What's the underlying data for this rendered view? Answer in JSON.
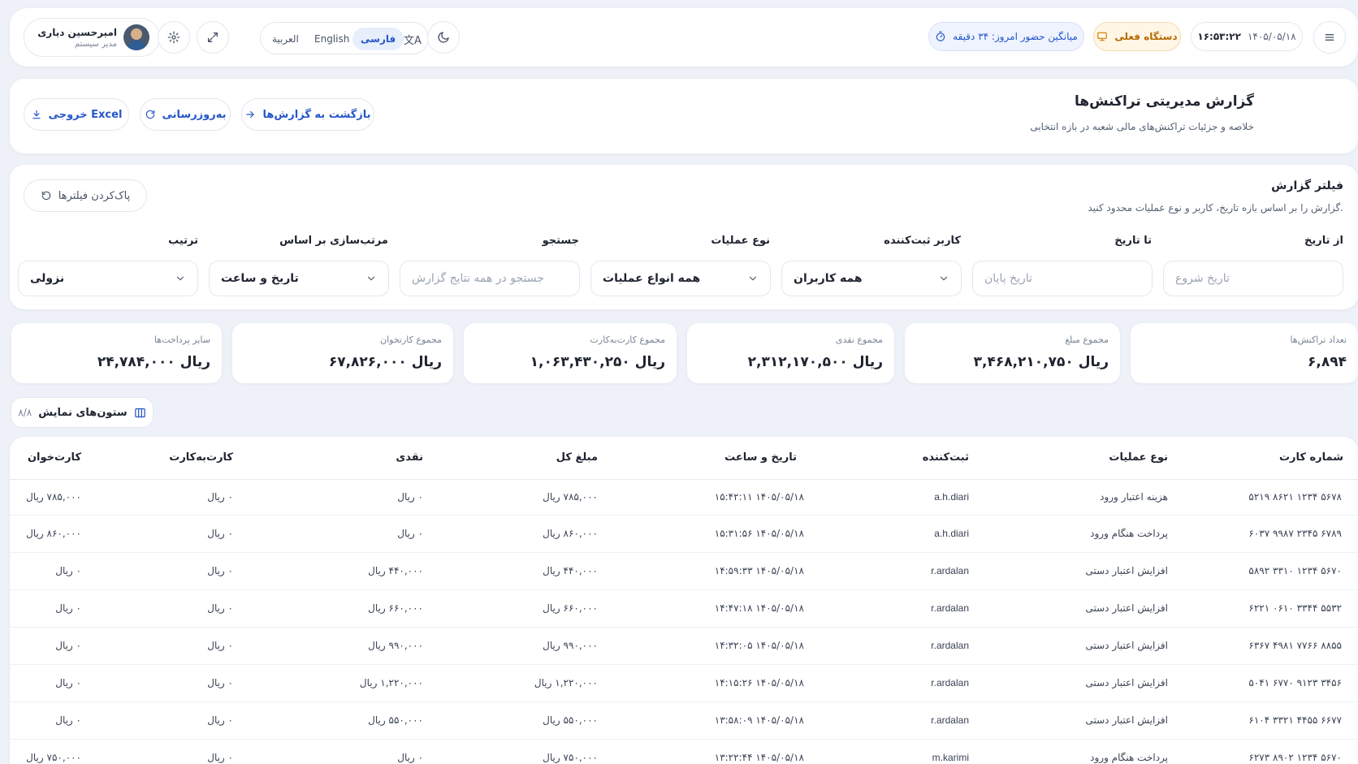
{
  "header": {
    "user_name": "امیرحسین دیاری",
    "user_role": "مدیر سیستم",
    "lang_arabic": "العربية",
    "lang_english": "English",
    "lang_farsi": "فارسی",
    "avg_presence": "میانگین حضور امروز: ۳۴ دقیقه",
    "current_device": "دستگاه فعلی",
    "time": "۱۶:۵۳:۲۲",
    "date": "۱۴۰۵/۰۵/۱۸"
  },
  "page": {
    "title": "گزارش مدیریتی تراکنش‌ها",
    "subtitle": "خلاصه و جزئیات تراکنش‌های مالی شعبه در بازه انتخابی",
    "back_label": "بازگشت به گزارش‌ها",
    "refresh_label": "به‌روزرسانی",
    "excel_label": "خروجی Excel"
  },
  "filter": {
    "title": "فیلتر گزارش",
    "description": "گزارش را بر اساس بازه تاریخ، کاربر و نوع عملیات محدود کنید.",
    "clear_label": "پاک‌کردن فیلترها",
    "from_label": "از تاریخ",
    "from_placeholder": "تاریخ شروع",
    "to_label": "تا تاریخ",
    "to_placeholder": "تاریخ پایان",
    "user_label": "کاربر ثبت‌کننده",
    "user_value": "همه کاربران",
    "op_label": "نوع عملیات",
    "op_value": "همه انواع عملیات",
    "search_label": "جستجو",
    "search_placeholder": "جستجو در همه نتایج گزارش",
    "sort_label": "مرتب‌سازی بر اساس",
    "sort_value": "تاریخ و ساعت",
    "order_label": "ترتیب",
    "order_value": "نزولی"
  },
  "stats": [
    {
      "label": "تعداد تراکنش‌ها",
      "value": "۶,۸۹۴"
    },
    {
      "label": "مجموع مبلغ",
      "value": "۳,۴۶۸,۲۱۰,۷۵۰ ریال"
    },
    {
      "label": "مجموع نقدی",
      "value": "۲,۳۱۲,۱۷۰,۵۰۰ ریال"
    },
    {
      "label": "مجموع کارت‌به‌کارت",
      "value": "۱,۰۶۳,۴۳۰,۲۵۰ ریال"
    },
    {
      "label": "مجموع کارتخوان",
      "value": "۶۷,۸۲۶,۰۰۰ ریال"
    },
    {
      "label": "سایر پرداخت‌ها",
      "value": "۲۴,۷۸۴,۰۰۰ ریال"
    }
  ],
  "columns_button": {
    "label": "ستون‌های نمایش",
    "count": "۸/۸"
  },
  "table": {
    "headers": [
      "شماره کارت",
      "نوع عملیات",
      "ثبت‌کننده",
      "تاریخ و ساعت",
      "مبلغ کل",
      "نقدی",
      "کارت‌به‌کارت",
      "کارت‌خوان"
    ],
    "rows": [
      [
        "۵۶۷۸ ۱۲۳۴ ۸۶۲۱ ۵۲۱۹",
        "هزینه اعتبار ورود",
        "a.h.diari",
        "۱۴۰۵/۰۵/۱۸   ۱۵:۴۲:۱۱",
        "۷۸۵,۰۰۰ ریال",
        "۰ ریال",
        "۰ ریال",
        "۷۸۵,۰۰۰ ریال"
      ],
      [
        "۶۷۸۹ ۲۳۴۵ ۹۹۸۷ ۶۰۳۷",
        "پرداخت هنگام ورود",
        "a.h.diari",
        "۱۴۰۵/۰۵/۱۸   ۱۵:۳۱:۵۶",
        "۸۶۰,۰۰۰ ریال",
        "۰ ریال",
        "۰ ریال",
        "۸۶۰,۰۰۰ ریال"
      ],
      [
        "۵۶۷۰ ۱۲۳۴ ۳۳۱۰ ۵۸۹۲",
        "افزایش اعتبار دستی",
        "r.ardalan",
        "۱۴۰۵/۰۵/۱۸   ۱۴:۵۹:۳۳",
        "۴۴۰,۰۰۰ ریال",
        "۴۴۰,۰۰۰ ریال",
        "۰ ریال",
        "۰ ریال"
      ],
      [
        "۵۵۳۲ ۳۳۴۴ ۰۶۱۰ ۶۲۲۱",
        "افزایش اعتبار دستی",
        "r.ardalan",
        "۱۴۰۵/۰۵/۱۸   ۱۴:۴۷:۱۸",
        "۶۶۰,۰۰۰ ریال",
        "۶۶۰,۰۰۰ ریال",
        "۰ ریال",
        "۰ ریال"
      ],
      [
        "۸۸۵۵ ۷۷۶۶ ۴۹۸۱ ۶۳۶۷",
        "افزایش اعتبار دستی",
        "r.ardalan",
        "۱۴۰۵/۰۵/۱۸   ۱۴:۳۲:۰۵",
        "۹۹۰,۰۰۰ ریال",
        "۹۹۰,۰۰۰ ریال",
        "۰ ریال",
        "۰ ریال"
      ],
      [
        "۳۴۵۶ ۹۱۲۳ ۶۷۷۰ ۵۰۴۱",
        "افزایش اعتبار دستی",
        "r.ardalan",
        "۱۴۰۵/۰۵/۱۸   ۱۴:۱۵:۲۶",
        "۱,۲۲۰,۰۰۰ ریال",
        "۱,۲۲۰,۰۰۰ ریال",
        "۰ ریال",
        "۰ ریال"
      ],
      [
        "۶۶۷۷ ۴۴۵۵ ۳۳۲۱ ۶۱۰۴",
        "افزایش اعتبار دستی",
        "r.ardalan",
        "۱۴۰۵/۰۵/۱۸   ۱۳:۵۸:۰۹",
        "۵۵۰,۰۰۰ ریال",
        "۵۵۰,۰۰۰ ریال",
        "۰ ریال",
        "۰ ریال"
      ],
      [
        "۵۶۷۰ ۱۲۳۴ ۸۹۰۲ ۶۲۷۳",
        "پرداخت هنگام ورود",
        "m.karimi",
        "۱۴۰۵/۰۵/۱۸   ۱۳:۲۲:۴۴",
        "۷۵۰,۰۰۰ ریال",
        "۰ ریال",
        "۰ ریال",
        "۷۵۰,۰۰۰ ریال"
      ]
    ]
  }
}
